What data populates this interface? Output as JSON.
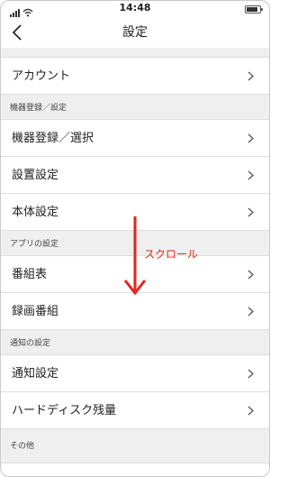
{
  "status_bar": {
    "time": "14:48"
  },
  "nav": {
    "title": "設定",
    "back_icon": "chevron-left-icon"
  },
  "sections": {
    "account": {
      "item_label": "アカウント"
    },
    "device": {
      "header": "機器登録／設定",
      "items": [
        "機器登録／選択",
        "設置設定",
        "本体設定"
      ]
    },
    "app": {
      "header": "アプリの設定",
      "items": [
        "番組表",
        "録画番組"
      ]
    },
    "notifications": {
      "header": "通知の設定",
      "items": [
        "通知設定",
        "ハードディスク残量"
      ]
    },
    "other": {
      "header": "その他"
    }
  },
  "annotation": {
    "label": "スクロール",
    "color": "#e0271f",
    "icon": "arrow-down-icon"
  }
}
